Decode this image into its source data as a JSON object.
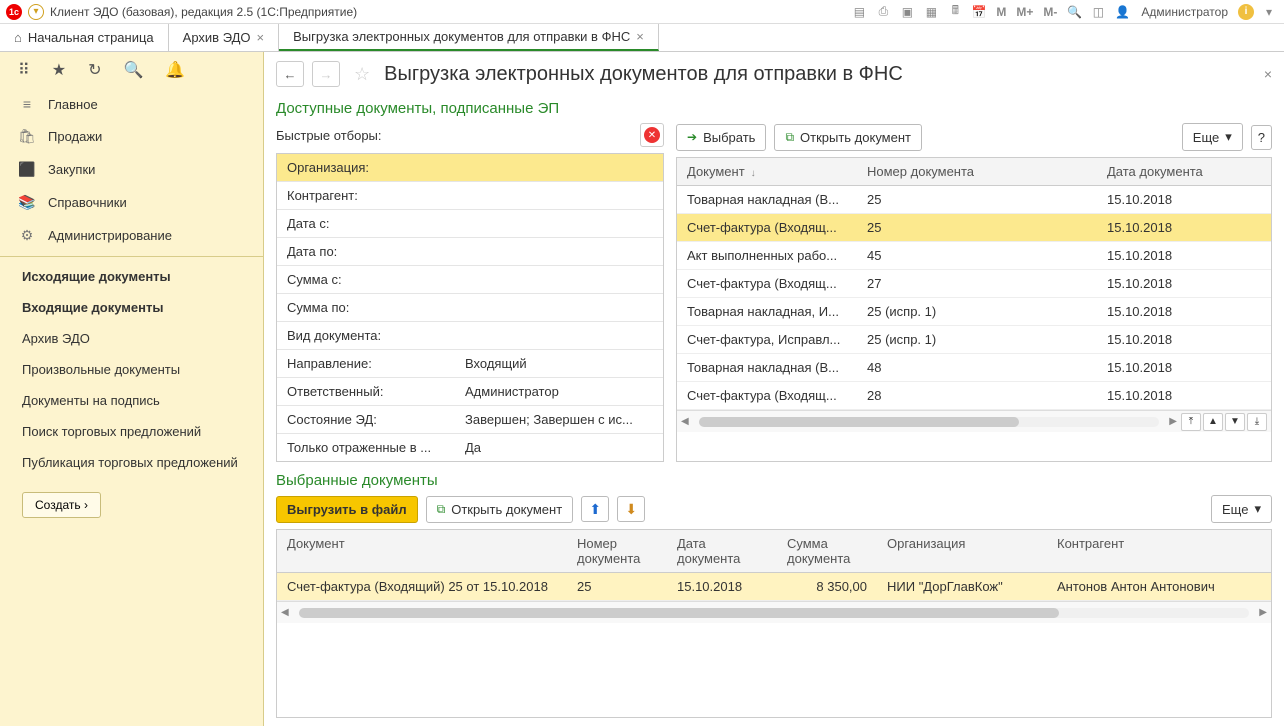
{
  "titlebar": {
    "app_title": "Клиент ЭДО (базовая), редакция 2.5  (1С:Предприятие)",
    "user": "Администратор",
    "m_labels": [
      "M",
      "M+",
      "M-"
    ]
  },
  "tabs": [
    {
      "label": "Начальная страница"
    },
    {
      "label": "Архив ЭДО"
    },
    {
      "label": "Выгрузка электронных документов для отправки в ФНС",
      "active": true
    }
  ],
  "sidebar": {
    "nav": [
      {
        "icon": "≡",
        "label": "Главное"
      },
      {
        "icon": "🛍",
        "label": "Продажи"
      },
      {
        "icon": "⬛",
        "label": "Закупки"
      },
      {
        "icon": "📚",
        "label": "Справочники"
      },
      {
        "icon": "⚙",
        "label": "Администрирование"
      }
    ],
    "links": [
      {
        "label": "Исходящие документы",
        "bold": true
      },
      {
        "label": "Входящие документы",
        "bold": true
      },
      {
        "label": "Архив ЭДО"
      },
      {
        "label": "Произвольные документы"
      },
      {
        "label": "Документы на подпись"
      },
      {
        "label": "Поиск торговых предложений"
      },
      {
        "label": "Публикация торговых предложений"
      }
    ],
    "create_btn": "Создать  ›"
  },
  "page": {
    "title": "Выгрузка электронных документов для отправки в ФНС",
    "section_available": "Доступные документы, подписанные ЭП",
    "section_selected": "Выбранные документы",
    "filters_label": "Быстрые отборы:",
    "filters": [
      {
        "label": "Организация:",
        "value": "",
        "selected": true
      },
      {
        "label": "Контрагент:",
        "value": ""
      },
      {
        "label": "Дата с:",
        "value": ""
      },
      {
        "label": "Дата по:",
        "value": ""
      },
      {
        "label": "Сумма с:",
        "value": ""
      },
      {
        "label": "Сумма по:",
        "value": ""
      },
      {
        "label": "Вид документа:",
        "value": ""
      },
      {
        "label": "Направление:",
        "value": "Входящий"
      },
      {
        "label": "Ответственный:",
        "value": "Администратор"
      },
      {
        "label": "Состояние ЭД:",
        "value": "Завершен; Завершен с ис..."
      },
      {
        "label": "Только отраженные в ...",
        "value": "Да"
      }
    ],
    "toolbar": {
      "select": "Выбрать",
      "open_doc": "Открыть документ",
      "more": "Еще",
      "help": "?"
    },
    "docs_columns": {
      "c1": "Документ",
      "c2": "Номер документа",
      "c3": "Дата документа"
    },
    "docs": [
      {
        "doc": "Товарная накладная (В...",
        "num": "25",
        "date": "15.10.2018"
      },
      {
        "doc": "Счет-фактура (Входящ...",
        "num": "25",
        "date": "15.10.2018",
        "selected": true
      },
      {
        "doc": "Акт выполненных рабо...",
        "num": "45",
        "date": "15.10.2018"
      },
      {
        "doc": "Счет-фактура (Входящ...",
        "num": "27",
        "date": "15.10.2018"
      },
      {
        "doc": "Товарная накладная, И...",
        "num": "25 (испр. 1)",
        "date": "15.10.2018"
      },
      {
        "doc": "Счет-фактура, Исправл...",
        "num": "25 (испр. 1)",
        "date": "15.10.2018"
      },
      {
        "doc": "Товарная накладная (В...",
        "num": "48",
        "date": "15.10.2018"
      },
      {
        "doc": "Счет-фактура (Входящ...",
        "num": "28",
        "date": "15.10.2018"
      }
    ],
    "bottom_toolbar": {
      "export": "Выгрузить в файл",
      "open_doc": "Открыть документ",
      "more": "Еще"
    },
    "bottom_columns": {
      "b1": "Документ",
      "b2": "Номер документа",
      "b3": "Дата документа",
      "b4": "Сумма документа",
      "b5": "Организация",
      "b6": "Контрагент"
    },
    "selected_docs": [
      {
        "doc": "Счет-фактура (Входящий) 25 от 15.10.2018",
        "num": "25",
        "date": "15.10.2018",
        "sum": "8 350,00",
        "org": "НИИ \"ДорГлавКож\"",
        "contr": "Антонов Антон Антонович"
      }
    ]
  }
}
